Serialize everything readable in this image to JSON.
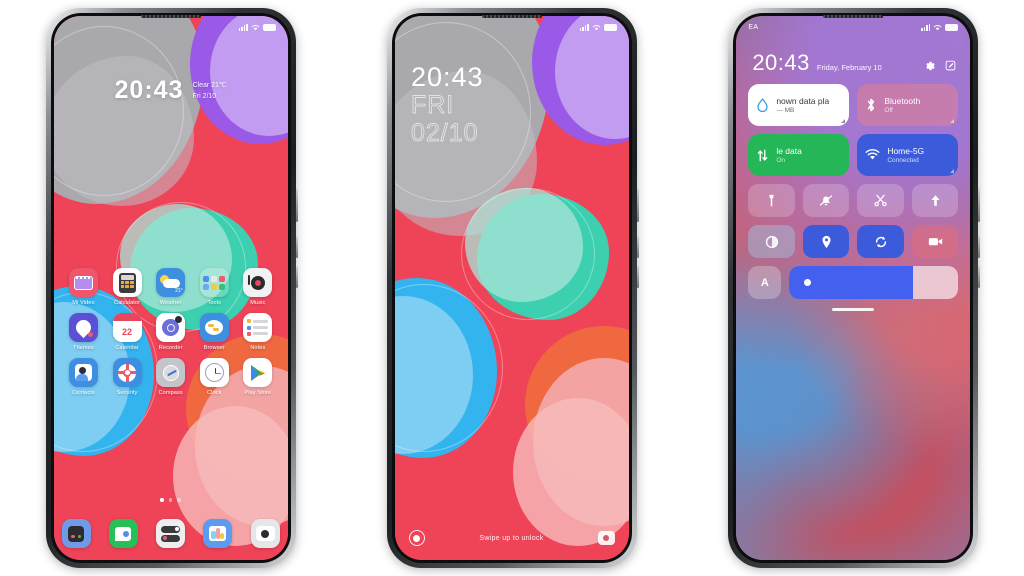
{
  "phones": [
    {
      "id": "home-screen",
      "status_bar": {
        "signal_icon": "signal-icon",
        "wifi_icon": "wifi-icon",
        "battery_icon": "battery-icon"
      },
      "clock": {
        "time": "20:43",
        "weather": "Clear  21℃",
        "date": "Fri  2/10"
      },
      "apps": [
        [
          {
            "label": "Mi Video",
            "icon": "mi-video-icon"
          },
          {
            "label": "Calculator",
            "icon": "calculator-icon"
          },
          {
            "label": "Weather",
            "icon": "weather-icon"
          },
          {
            "label": "Tools",
            "icon": "tools-folder-icon"
          },
          {
            "label": "Music",
            "icon": "music-icon"
          }
        ],
        [
          {
            "label": "Themes",
            "icon": "themes-icon"
          },
          {
            "label": "Calendar",
            "icon": "calendar-icon"
          },
          {
            "label": "Recorder",
            "icon": "recorder-icon"
          },
          {
            "label": "Browser",
            "icon": "browser-icon"
          },
          {
            "label": "Notes",
            "icon": "notes-icon"
          }
        ],
        [
          {
            "label": "Contacts",
            "icon": "contacts-icon"
          },
          {
            "label": "Security",
            "icon": "security-icon"
          },
          {
            "label": "Compass",
            "icon": "compass-icon"
          },
          {
            "label": "Clock",
            "icon": "clock-icon"
          },
          {
            "label": "Play Store",
            "icon": "play-store-icon"
          }
        ]
      ],
      "calendar_day": "22",
      "weather_temp": "21°",
      "page_dots": 3,
      "active_dot": 1,
      "dock": [
        {
          "icon": "phone-dialer-icon"
        },
        {
          "icon": "messages-icon"
        },
        {
          "icon": "settings-list-icon"
        },
        {
          "icon": "gallery-icon"
        },
        {
          "icon": "camera-icon"
        }
      ]
    },
    {
      "id": "lock-screen",
      "status_bar": {
        "signal_icon": "signal-icon",
        "wifi_icon": "wifi-icon",
        "battery_icon": "battery-icon"
      },
      "clock": {
        "time": "20:43",
        "weekday": "FRI",
        "date": "02/10"
      },
      "bottom": {
        "left_icon": "assistant-button-icon",
        "hint": "Swipe up to unlock",
        "right_icon": "camera-shortcut-icon"
      }
    },
    {
      "id": "control-center",
      "carrier": "EA",
      "status_bar": {
        "signal_icon": "signal-icon",
        "wifi_icon": "wifi-icon",
        "battery_icon": "battery-icon"
      },
      "header": {
        "time": "20:43",
        "date": "Friday, February 10",
        "settings_icon": "gear-icon",
        "edit_icon": "edit-icon"
      },
      "tiles": [
        {
          "title": "nown data pla",
          "subtitle": "--- MB",
          "icon": "data-usage-drop-icon",
          "bg": "#ffffff",
          "fg": "#3a3a3a",
          "accent": "#2e9ee0",
          "expand": true
        },
        {
          "title": "Bluetooth",
          "subtitle": "Off",
          "icon": "bluetooth-icon",
          "bg": "rgba(232,130,138,0.55)",
          "fg": "#ffffff",
          "accent": "#ffffff",
          "expand": true
        },
        {
          "title": "le data",
          "subtitle": "On",
          "icon": "mobile-data-icon",
          "bg": "#25b658",
          "fg": "#ffffff",
          "accent": "#ffffff",
          "expand": false
        },
        {
          "title": "Home-5G",
          "subtitle": "Connected",
          "icon": "wifi-icon",
          "bg": "#3b5bdb",
          "fg": "#ffffff",
          "accent": "#ffffff",
          "expand": true
        }
      ],
      "toggles": [
        {
          "name": "flashlight-icon",
          "on": false
        },
        {
          "name": "silent-bell-icon",
          "on": false
        },
        {
          "name": "scissors-screenshot-icon",
          "on": false
        },
        {
          "name": "cast-upload-icon",
          "on": false
        },
        {
          "name": "dark-mode-icon",
          "on": false
        },
        {
          "name": "location-pin-icon",
          "on": true
        },
        {
          "name": "auto-rotate-icon",
          "on": true
        },
        {
          "name": "screen-recorder-icon",
          "on": false
        }
      ],
      "brightness": {
        "auto_label": "A",
        "level_percent": 73,
        "thumb_icon": "sun-icon"
      },
      "home_indicator": true
    }
  ]
}
